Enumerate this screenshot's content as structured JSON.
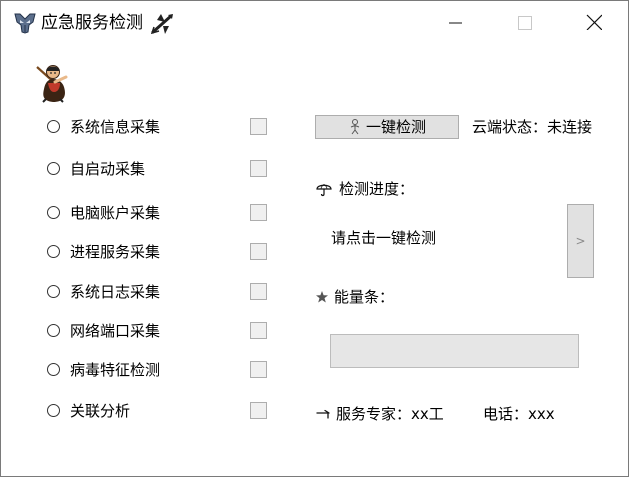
{
  "window": {
    "title": "应急服务检测",
    "app_icon": "transformer-logo-icon",
    "title_decoration_icon": "airplane-icon"
  },
  "options": [
    {
      "label": "系统信息采集",
      "radio_selected": false,
      "checked": false
    },
    {
      "label": "自启动采集",
      "radio_selected": false,
      "checked": false
    },
    {
      "label": "电脑账户采集",
      "radio_selected": false,
      "checked": false
    },
    {
      "label": "进程服务采集",
      "radio_selected": false,
      "checked": false
    },
    {
      "label": "系统日志采集",
      "radio_selected": false,
      "checked": false
    },
    {
      "label": "网络端口采集",
      "radio_selected": false,
      "checked": false
    },
    {
      "label": "病毒特征检测",
      "radio_selected": false,
      "checked": false
    },
    {
      "label": "关联分析",
      "radio_selected": false,
      "checked": false
    }
  ],
  "one_click": {
    "label": "一键检测",
    "icon": "person-icon"
  },
  "cloud": {
    "status_text": "云端状态：未连接"
  },
  "progress": {
    "label": "检测进度：",
    "icon": "umbrella-icon",
    "text": "请点击一键检测",
    "next_label": ">"
  },
  "energy": {
    "label": "能量条：",
    "icon": "star-icon",
    "value_percent": 0
  },
  "footer": {
    "expert": "服务专家：xx工",
    "phone": "电话：xxx",
    "expert_icon": "arrow-icon"
  }
}
